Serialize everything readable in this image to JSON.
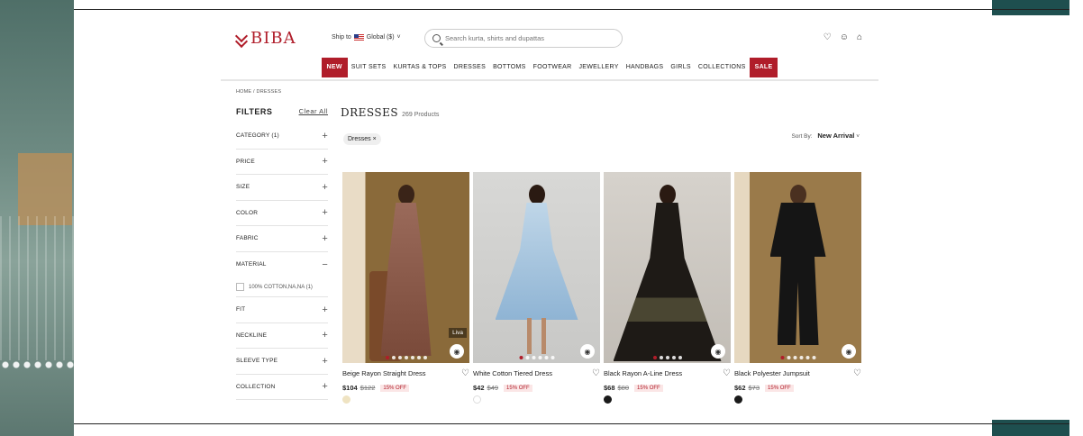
{
  "brand": {
    "logo_text": "BIBA",
    "accent": "#b01d2a"
  },
  "header": {
    "ship_label": "Ship to",
    "ship_region": "Global ($)",
    "search_placeholder": "Search kurta, shirts and dupattas",
    "icons": [
      "heart-icon",
      "user-icon",
      "bag-icon"
    ]
  },
  "nav": [
    "NEW",
    "SUIT SETS",
    "KURTAS & TOPS",
    "DRESSES",
    "BOTTOMS",
    "FOOTWEAR",
    "JEWELLERY",
    "HANDBAGS",
    "GIRLS",
    "COLLECTIONS",
    "SALE"
  ],
  "breadcrumb": {
    "home": "HOME",
    "sep": "/",
    "current": "DRESSES"
  },
  "filters": {
    "title": "FILTERS",
    "clear": "Clear All",
    "rows": [
      {
        "label": "CATEGORY (1)",
        "sign": "+"
      },
      {
        "label": "PRICE",
        "sign": "+"
      },
      {
        "label": "SIZE",
        "sign": "+"
      },
      {
        "label": "COLOR",
        "sign": "+"
      },
      {
        "label": "FABRIC",
        "sign": "+"
      },
      {
        "label": "MATERIAL",
        "sign": "−"
      },
      {
        "label": "FIT",
        "sign": "+"
      },
      {
        "label": "NECKLINE",
        "sign": "+"
      },
      {
        "label": "SLEEVE TYPE",
        "sign": "+"
      },
      {
        "label": "COLLECTION",
        "sign": "+"
      }
    ],
    "material_option": "100% COTTON,NA,NA (1)"
  },
  "listing": {
    "title": "DRESSES",
    "count": "269 Products",
    "chip": "Dresses ×",
    "sort_label": "Sort By:",
    "sort_value": "New Arrival"
  },
  "products": [
    {
      "name": "Beige Rayon Straight Dress",
      "price": "$104",
      "mrp": "$122",
      "off": "15% OFF",
      "swatch": "#efe3c2",
      "badge": "Liva"
    },
    {
      "name": "White Cotton Tiered Dress",
      "price": "$42",
      "mrp": "$49",
      "off": "15% OFF",
      "swatch": "#ffffff",
      "badge": ""
    },
    {
      "name": "Black Rayon A-Line Dress",
      "price": "$68",
      "mrp": "$80",
      "off": "15% OFF",
      "swatch": "#1a1a1a",
      "badge": ""
    },
    {
      "name": "Black Polyester Jumpsuit",
      "price": "$62",
      "mrp": "$73",
      "off": "15% OFF",
      "swatch": "#1a1a1a",
      "badge": ""
    }
  ]
}
